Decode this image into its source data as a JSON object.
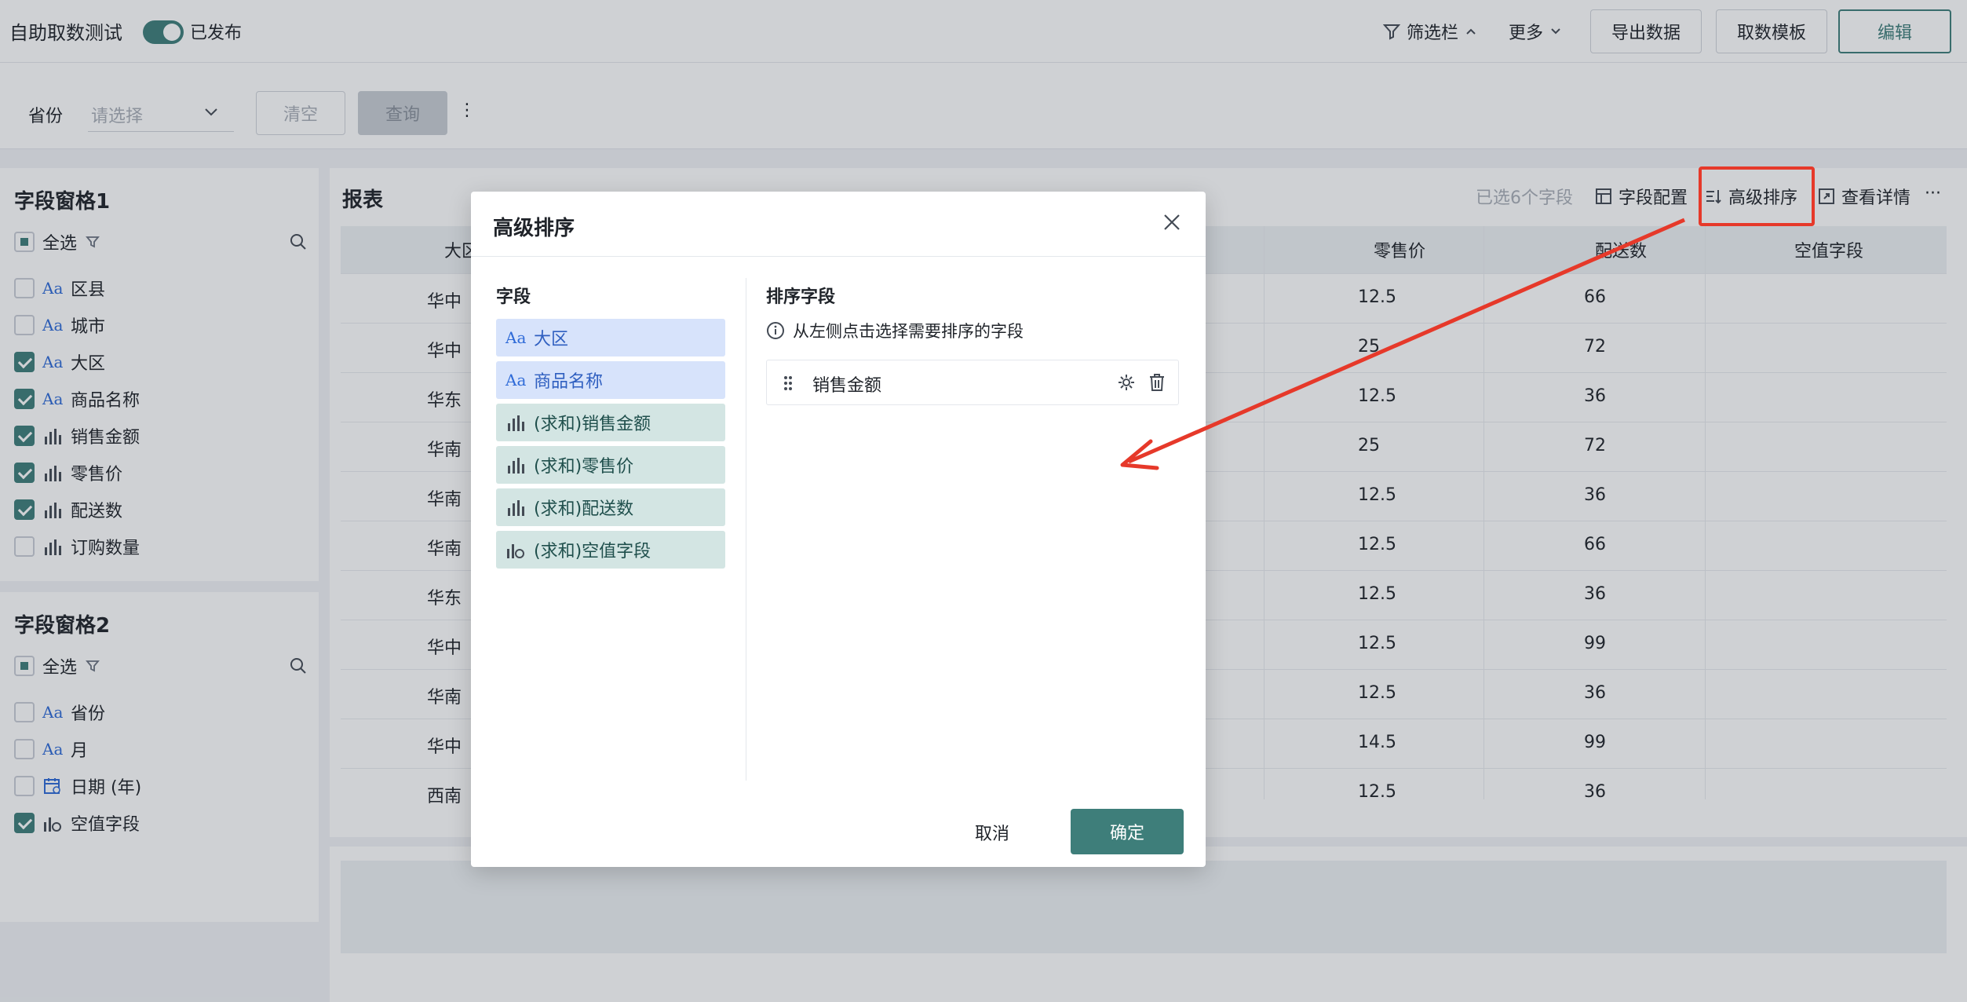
{
  "topbar": {
    "title": "自助取数测试",
    "publish_status": "已发布",
    "filter_toggle": "筛选栏",
    "more": "更多",
    "export": "导出数据",
    "template": "取数模板",
    "edit": "编辑"
  },
  "filter": {
    "province_label": "省份",
    "province_placeholder": "请选择",
    "clear": "清空",
    "query": "查询",
    "more_icon": "⋮"
  },
  "panel1": {
    "title": "字段窗格1",
    "select_all": "全选",
    "items": [
      {
        "label": "区县",
        "type": "dim",
        "checked": false
      },
      {
        "label": "城市",
        "type": "dim",
        "checked": false
      },
      {
        "label": "大区",
        "type": "dim",
        "checked": true
      },
      {
        "label": "商品名称",
        "type": "dim",
        "checked": true
      },
      {
        "label": "销售金额",
        "type": "mea",
        "checked": true
      },
      {
        "label": "零售价",
        "type": "mea",
        "checked": true
      },
      {
        "label": "配送数",
        "type": "mea",
        "checked": true
      },
      {
        "label": "订购数量",
        "type": "mea",
        "checked": false
      }
    ]
  },
  "panel2": {
    "title": "字段窗格2",
    "select_all": "全选",
    "items": [
      {
        "label": "省份",
        "type": "dim",
        "checked": false
      },
      {
        "label": "月",
        "type": "dim",
        "checked": false
      },
      {
        "label": "日期 (年)",
        "type": "date",
        "checked": false
      },
      {
        "label": "空值字段",
        "type": "calc",
        "checked": true
      }
    ]
  },
  "report": {
    "title": "报表",
    "selected_count": "已选6个字段",
    "field_config": "字段配置",
    "advanced_sort": "高级排序",
    "view_detail": "查看详情",
    "more": "···",
    "columns": [
      "大区",
      "零售价",
      "配送数",
      "空值字段"
    ],
    "rows": [
      [
        "华中",
        "12.5",
        "66",
        ""
      ],
      [
        "华中",
        "25",
        "72",
        ""
      ],
      [
        "华东",
        "12.5",
        "36",
        ""
      ],
      [
        "华南",
        "25",
        "72",
        ""
      ],
      [
        "华南",
        "12.5",
        "36",
        ""
      ],
      [
        "华南",
        "12.5",
        "66",
        ""
      ],
      [
        "华东",
        "12.5",
        "36",
        ""
      ],
      [
        "华中",
        "12.5",
        "99",
        ""
      ],
      [
        "华南",
        "12.5",
        "36",
        ""
      ],
      [
        "华中",
        "14.5",
        "99",
        ""
      ],
      [
        "西南",
        "12.5",
        "36",
        ""
      ]
    ]
  },
  "modal": {
    "title": "高级排序",
    "fields_title": "字段",
    "sort_title": "排序字段",
    "hint": "从左侧点击选择需要排序的字段",
    "fields": [
      {
        "label": "大区",
        "type": "dim"
      },
      {
        "label": "商品名称",
        "type": "dim"
      },
      {
        "label": "(求和)销售金额",
        "type": "mea"
      },
      {
        "label": "(求和)零售价",
        "type": "mea"
      },
      {
        "label": "(求和)配送数",
        "type": "mea"
      },
      {
        "label": "(求和)空值字段",
        "type": "calc"
      }
    ],
    "sort_fields": [
      "销售金额"
    ],
    "cancel": "取消",
    "ok": "确定"
  },
  "colors": {
    "accent": "#3e7e7a",
    "annotation": "#e6392a"
  }
}
